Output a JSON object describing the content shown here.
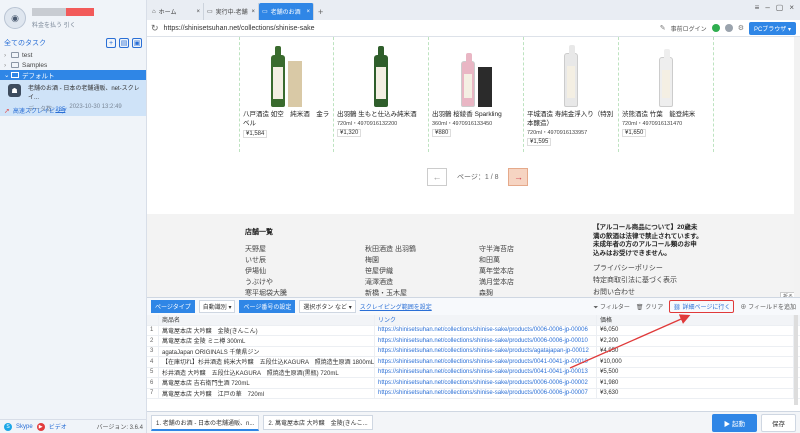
{
  "sidebar": {
    "user_sub": "料金を払う 引く",
    "all_tasks": "全てのタスク",
    "folders": [
      {
        "label": "test"
      },
      {
        "label": "Samples"
      }
    ],
    "default_folder": "デフォルト",
    "task": {
      "title": "老舗のお酒 - 日本の老舗通販、net-スクレイ...",
      "meta_label": "データ数:",
      "meta_count": "285",
      "meta_date": "2023-10-30 13:2:49",
      "quick_label": "高速スクレイピング"
    },
    "bottom": {
      "skype": "Skype",
      "video": "ビデオ",
      "version": "バージョン: 3.6.4"
    }
  },
  "browser": {
    "tabs": [
      {
        "label": "ホーム"
      },
      {
        "label": "実行中-老舗"
      },
      {
        "label": "老舗のお酒"
      }
    ],
    "url": "https://shinisetsuhan.net/collections/shinise-sake",
    "login": "事前ログイン",
    "pc_browser": "PCブラウザ",
    "status_colors": {
      "green": "#2fae4f",
      "gray": "#9aa3ad"
    }
  },
  "products": [
    {
      "name": "八戸酒造 如空　純米酒　金ラベル",
      "spec": "",
      "price": "¥1,584",
      "label_text": "如空",
      "bottle_color": "#3a6b2e",
      "box": true
    },
    {
      "name": "出羽鶴 生もと仕込み純米酒",
      "spec": "720ml・4970916132200",
      "price": "¥1,320",
      "label_text": "",
      "bottle_color": "#2f5e2b",
      "box": false
    },
    {
      "name": "出羽鶴 桜綾香 Sparkling",
      "spec": "360ml・4970916133450",
      "price": "¥880",
      "label_text": "",
      "bottle_color": "#e9b6c4",
      "box": true
    },
    {
      "name": "平城酒造 寿純金浮入り（特別本醸造）",
      "spec": "720ml・4970916133957",
      "price": "¥1,595",
      "label_text": "",
      "bottle_color": "#e8e8e8",
      "box": false
    },
    {
      "name": "渋熊酒造 竹葉　能登純米",
      "spec": "720ml・4970916131470",
      "price": "¥1,650",
      "label_text": "",
      "bottle_color": "#eeeeee",
      "box": false
    }
  ],
  "pager": {
    "prev": "←",
    "text": "ページ：1 / 8",
    "next": "→"
  },
  "footer": {
    "title": "店舗一覧",
    "col1": [
      "天野屋",
      "いせ辰",
      "伊場仙",
      "うぶけや",
      "寒平堀袋大騰"
    ],
    "col2": [
      "秋田酒造 出羽鶴",
      "梅園",
      "笹屋伊織",
      "滝澤酒造",
      "新橋・玉木屋"
    ],
    "col3": [
      "守半海苔店",
      "和田萬",
      "萬年堂本店",
      "満月堂本店",
      "森麹"
    ],
    "notice": "【アルコール商品について】20歳未満の飲酒は法律で禁止されています。未成年者の方のアルコール類のお申込みはお受けできません。",
    "links": [
      "プライバシーポリシー",
      "特定商取引法に基づく表示",
      "お問い合わせ"
    ],
    "fold": "折る"
  },
  "toolbar": {
    "page_type_label": "ページタイプ",
    "page_type_value": "自動識別",
    "page_num_label": "ページ番号の設定",
    "page_num_value": "選択ボタン など",
    "scroll_link": "スクレイピング範囲を設定",
    "filter": "フィルター",
    "clear": "クリア",
    "detail": "詳細ページに行く",
    "add_field": "フィールドを追加"
  },
  "table": {
    "headers": [
      "",
      "商品名",
      "リンク",
      "価格"
    ],
    "rows": [
      [
        "1",
        "萬竜屋本店 大吟醸　金陵(きんこん)",
        "https://shinisetsuhan.net/collections/shinise-sake/products/0006-0006-jp-00006",
        "¥6,050"
      ],
      [
        "2",
        "萬竜屋本店 金陵 ミニ樽 300mL",
        "https://shinisetsuhan.net/collections/shinise-sake/products/0006-0006-jp-00010",
        "¥2,200"
      ],
      [
        "3",
        "agataJapan ORIGINALS 千葉県ジン",
        "https://shinisetsuhan.net/collections/shinise-sake/products/agatajapan-jp-00012",
        "¥4,950"
      ],
      [
        "4",
        "【在庫切れ】杉井酒造 純米大吟醸　五段仕込KAGURA　照焼造生原酒 1800mL",
        "https://shinisetsuhan.net/collections/shinise-sake/products/0041-0041-jp-00010",
        "¥10,000"
      ],
      [
        "5",
        "杉井酒造 大吟醸　五段仕込KAGURA　照焼造生原酒(黒瓶) 720mL",
        "https://shinisetsuhan.net/collections/shinise-sake/products/0041-0041-jp-00013",
        "¥5,500"
      ],
      [
        "6",
        "萬竜屋本店 吉右衛門生酒 720mL",
        "https://shinisetsuhan.net/collections/shinise-sake/products/0006-0006-jp-00002",
        "¥1,980"
      ],
      [
        "7",
        "萬竜屋本店 大吟醸　江戸の華　720ml",
        "https://shinisetsuhan.net/collections/shinise-sake/products/0006-0006-jp-00007",
        "¥3,630"
      ]
    ]
  },
  "bottom_bar": {
    "tab1": "1. 老舗のお酒 - 日本の老舗通販、n...",
    "tab2": "2. 萬竜屋本店 大吟醸　金陵(きんこ...",
    "run": "▶ 起動",
    "save": "保存"
  },
  "colors": {
    "accent": "#2f86e6",
    "annotation": "#e03a3a"
  }
}
